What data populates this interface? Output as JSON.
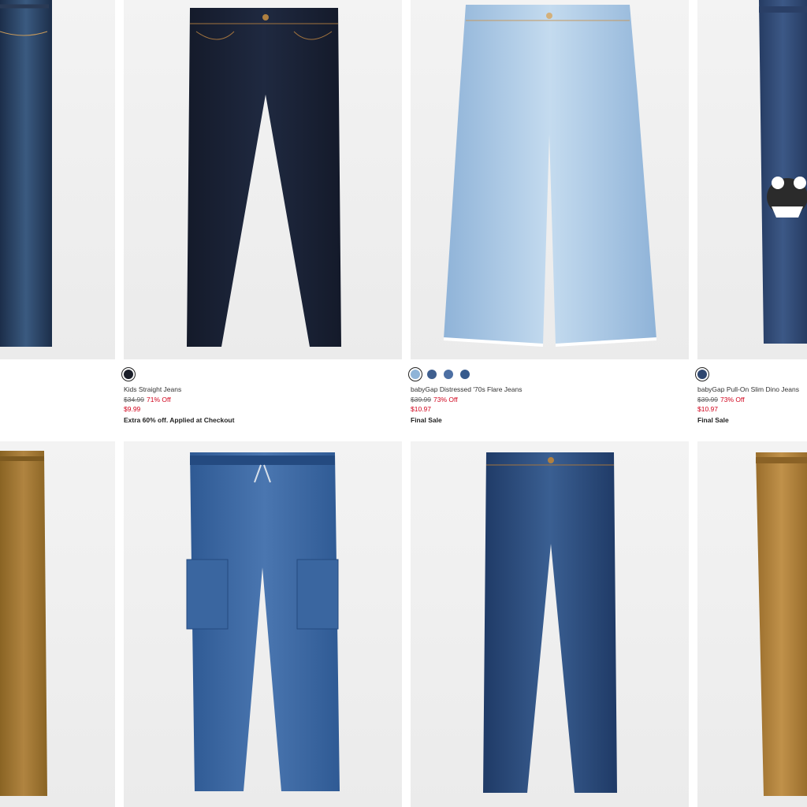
{
  "products": {
    "p1": {
      "image": "dark-wash-jeans-image",
      "swatches": []
    },
    "p2": {
      "image": "rinse-wash-straight-jeans-image",
      "name": "Kids Straight Jeans",
      "original_price": "$34.99",
      "discount": "71% Off",
      "sale_price": "$9.99",
      "note": "Extra 60% off. Applied at Checkout",
      "swatches": [
        "#1b1f2a"
      ]
    },
    "p3": {
      "image": "light-wash-flare-jeans-image",
      "name": "babyGap Distressed '70s Flare Jeans",
      "original_price": "$39.99",
      "discount": "73% Off",
      "sale_price": "$10.97",
      "note": "Final Sale",
      "swatches": [
        "#8fb4d8",
        "#3f5f8f",
        "#4c6fa3",
        "#365a8c"
      ]
    },
    "p4": {
      "image": "dino-pull-on-jeans-image",
      "name": "babyGap Pull-On Slim Dino Jeans",
      "original_price": "$39.99",
      "discount": "73% Off",
      "sale_price": "$10.97",
      "note": "Final Sale",
      "swatches": [
        "#2f4770"
      ]
    },
    "p5": {
      "image": "khaki-pull-on-pants-image"
    },
    "p6": {
      "image": "denim-cargo-joggers-image"
    },
    "p7": {
      "image": "medium-wash-slim-jeans-image"
    },
    "p8": {
      "image": "khaki-pull-on-pants-image"
    }
  }
}
